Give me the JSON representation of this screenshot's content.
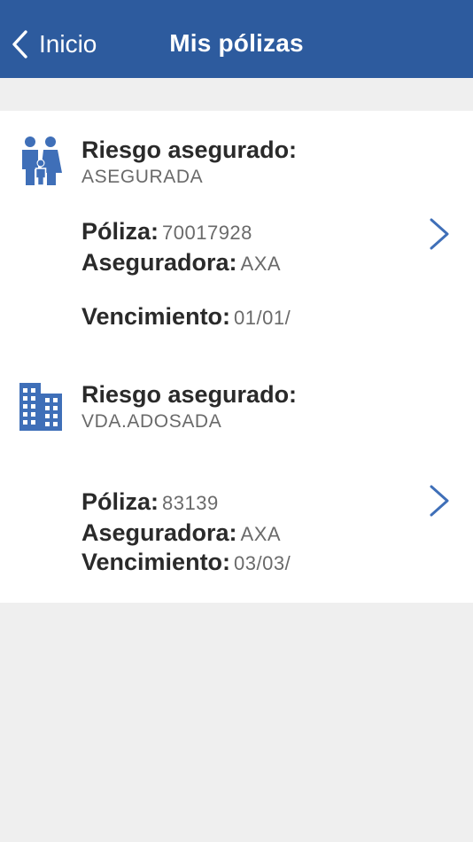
{
  "header": {
    "back_label": "Inicio",
    "title": "Mis pólizas"
  },
  "policies": [
    {
      "icon": "family-icon",
      "risk_label": "Riesgo asegurado:",
      "risk_value": "ASEGURADA",
      "policy_label": "Póliza:",
      "policy_value": "70017928",
      "insurer_label": "Aseguradora:",
      "insurer_value": "AXA",
      "expiry_label": "Vencimiento:",
      "expiry_value": "01/01/"
    },
    {
      "icon": "building-icon",
      "risk_label": "Riesgo asegurado:",
      "risk_value": "VDA.ADOSADA",
      "policy_label": "Póliza:",
      "policy_value": "83139",
      "insurer_label": "Aseguradora:",
      "insurer_value": "AXA",
      "expiry_label": "Vencimiento:",
      "expiry_value": "03/03/"
    }
  ],
  "colors": {
    "header_bg": "#2d5b9e",
    "accent": "#3f6fb8",
    "page_bg": "#efefef"
  }
}
